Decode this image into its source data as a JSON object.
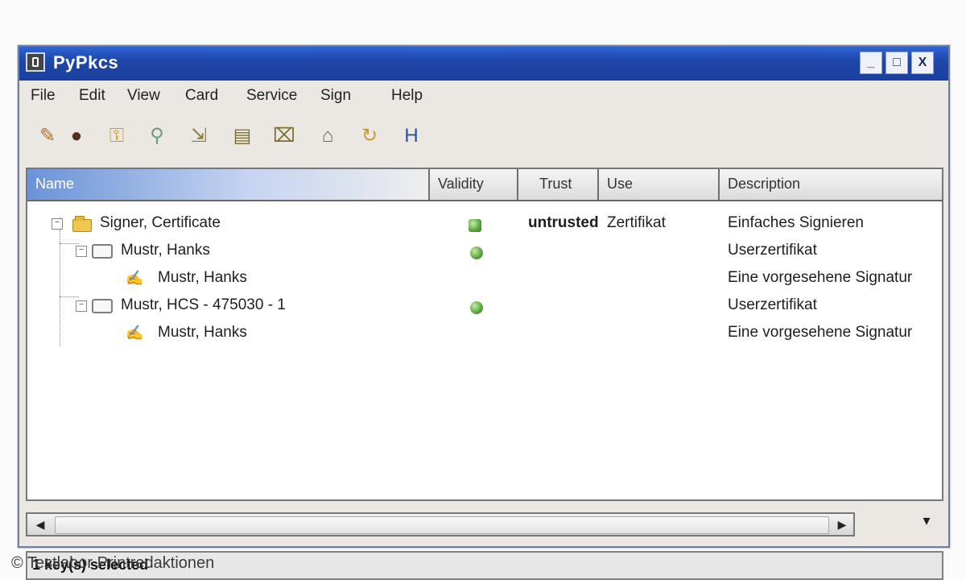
{
  "window": {
    "title": "PyPkcs",
    "controls": {
      "minimize": "_",
      "maximize": "□",
      "close": "X"
    }
  },
  "menu": {
    "items": [
      "File",
      "Edit",
      "View",
      "Card",
      "Service",
      "Sign",
      "Help"
    ]
  },
  "toolbar": {
    "icons": [
      "pencil-icon",
      "bomb-icon",
      "key-icon",
      "key-search-icon",
      "import-icon",
      "card-icon",
      "card-key-icon",
      "door-icon",
      "refresh-icon",
      "help-icon"
    ]
  },
  "list": {
    "columns": [
      "Name",
      "Validity",
      "Trust",
      "Use",
      "Description"
    ],
    "rows": [
      {
        "name": "Signer, Certificate",
        "validity_icon": "validity-badge-icon",
        "trust": "untrusted",
        "use": "Zertifikat",
        "description": "Einfaches Signieren"
      },
      {
        "name": "Mustr, Hanks",
        "validity_icon": "validity-ok-icon",
        "trust": "",
        "use": "",
        "description": "Userzertifikat"
      },
      {
        "name": "Mustr, Hanks",
        "validity_icon": "",
        "trust": "",
        "use": "",
        "description": "Eine vorgesehene Signatur"
      },
      {
        "name": "Mustr, HCS - 475030 - 1",
        "validity_icon": "validity-ok-icon",
        "trust": "",
        "use": "",
        "description": "Userzertifikat"
      },
      {
        "name": "Mustr, Hanks",
        "validity_icon": "",
        "trust": "",
        "use": "",
        "description": "Eine vorgesehene Signatur"
      }
    ]
  },
  "statusbar": {
    "text": "1 key(s) selected"
  },
  "caption": "© Testlabor Printredaktionen"
}
